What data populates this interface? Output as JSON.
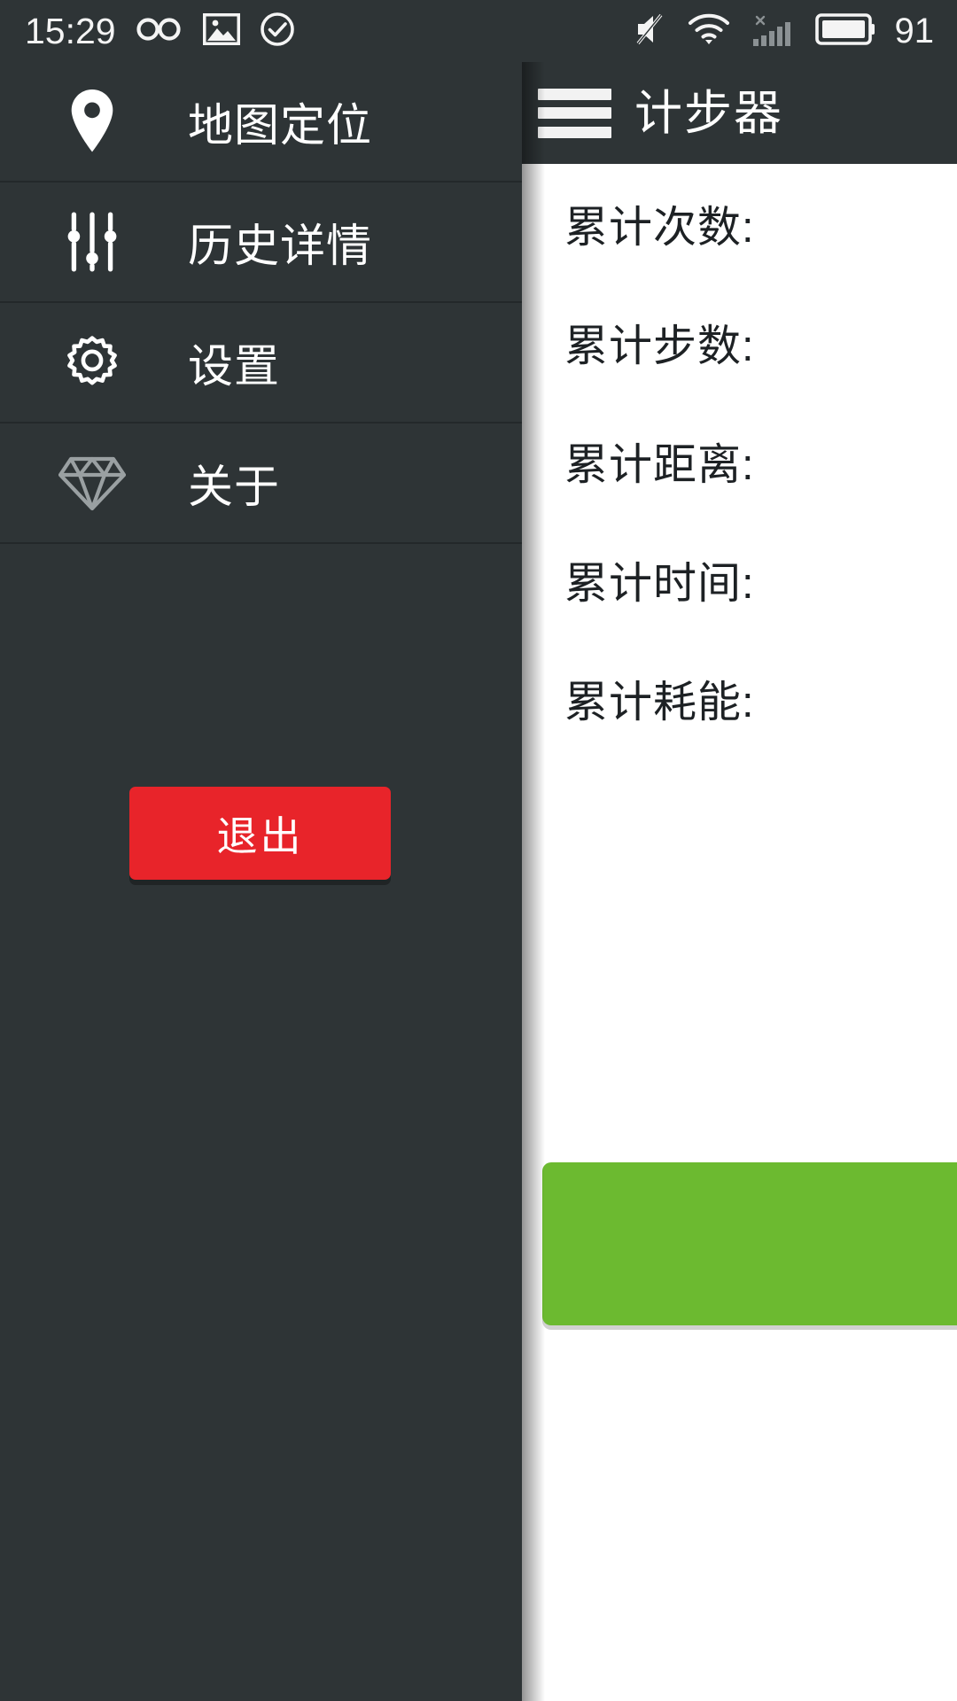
{
  "statusbar": {
    "time": "15:29",
    "battery_percent": "91",
    "icons": [
      {
        "name": "infinity-icon"
      },
      {
        "name": "image-icon"
      },
      {
        "name": "check-circle-icon"
      },
      {
        "name": "mute-icon"
      },
      {
        "name": "wifi-icon"
      },
      {
        "name": "signal-bars-no-service-icon"
      },
      {
        "name": "battery-icon"
      }
    ]
  },
  "app": {
    "title": "计步器",
    "menu_icon": "hamburger-menu-icon",
    "stats": [
      {
        "label": "累计次数:",
        "value": ""
      },
      {
        "label": "累计步数:",
        "value": ""
      },
      {
        "label": "累计距离:",
        "value": ""
      },
      {
        "label": "累计时间:",
        "value": ""
      },
      {
        "label": "累计耗能:",
        "value": ""
      }
    ],
    "start_button_label": ""
  },
  "drawer": {
    "items": [
      {
        "label": "地图定位",
        "icon": "map-pin-icon"
      },
      {
        "label": "历史详情",
        "icon": "sliders-icon"
      },
      {
        "label": "设置",
        "icon": "gear-icon"
      },
      {
        "label": "关于",
        "icon": "diamond-icon"
      }
    ],
    "exit_button_label": "退出"
  },
  "colors": {
    "drawer_bg": "#2e3436",
    "divider": "#23282a",
    "exit_red": "#e8242a",
    "start_green": "#6cba30",
    "panel_bg": "#ffffff",
    "text_light": "#ffffff",
    "text_dark": "#1d2124",
    "icon_muted": "#9aa0a2"
  }
}
